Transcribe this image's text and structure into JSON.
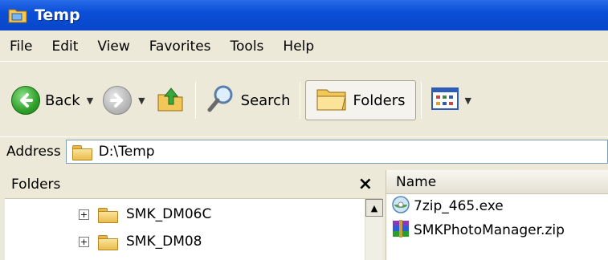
{
  "window": {
    "title": "Temp"
  },
  "menu": [
    "File",
    "Edit",
    "View",
    "Favorites",
    "Tools",
    "Help"
  ],
  "toolbar": {
    "back_label": "Back",
    "search_label": "Search",
    "folders_label": "Folders"
  },
  "address": {
    "label": "Address",
    "value": "D:\\Temp"
  },
  "folders_pane": {
    "title": "Folders",
    "close_glyph": "×",
    "tree": [
      {
        "label": "SMK_DM06C",
        "expander": "+"
      },
      {
        "label": "SMK_DM08",
        "expander": "+"
      }
    ]
  },
  "files_pane": {
    "column_name": "Name",
    "files": [
      {
        "name": "7zip_465.exe",
        "icon": "exe-installer-icon"
      },
      {
        "name": "SMKPhotoManager.zip",
        "icon": "winrar-archive-icon"
      }
    ]
  },
  "colors": {
    "titlebar": "#0A4FD8",
    "chrome": "#ECE9D8",
    "folder": "#E8BD4F"
  }
}
